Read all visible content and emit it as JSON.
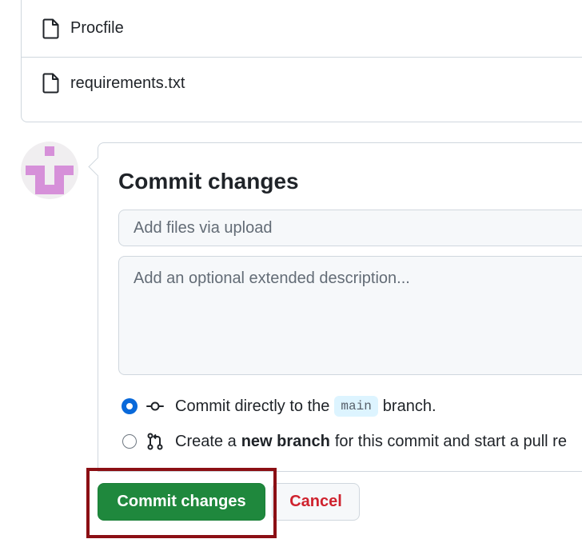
{
  "files": [
    {
      "name": "Procfile",
      "icon": "file-icon"
    },
    {
      "name": "requirements.txt",
      "icon": "file-icon"
    }
  ],
  "commit": {
    "title": "Commit changes",
    "summary_placeholder": "Add files via upload",
    "description_placeholder": "Add an optional extended description...",
    "option_direct": {
      "prefix": "Commit directly to the",
      "branch": "main",
      "suffix": "branch.",
      "selected": true
    },
    "option_new_branch": {
      "prefix": "Create a",
      "bold": "new branch",
      "suffix": "for this commit and start a pull re",
      "selected": false
    },
    "commit_button_label": "Commit changes",
    "cancel_button_label": "Cancel"
  },
  "colors": {
    "primary_button": "#1f883d",
    "cancel_text": "#cf222e",
    "radio_selected": "#0969da",
    "highlight_box": "#8b0f14",
    "avatar_pixels": "#d690d9"
  }
}
